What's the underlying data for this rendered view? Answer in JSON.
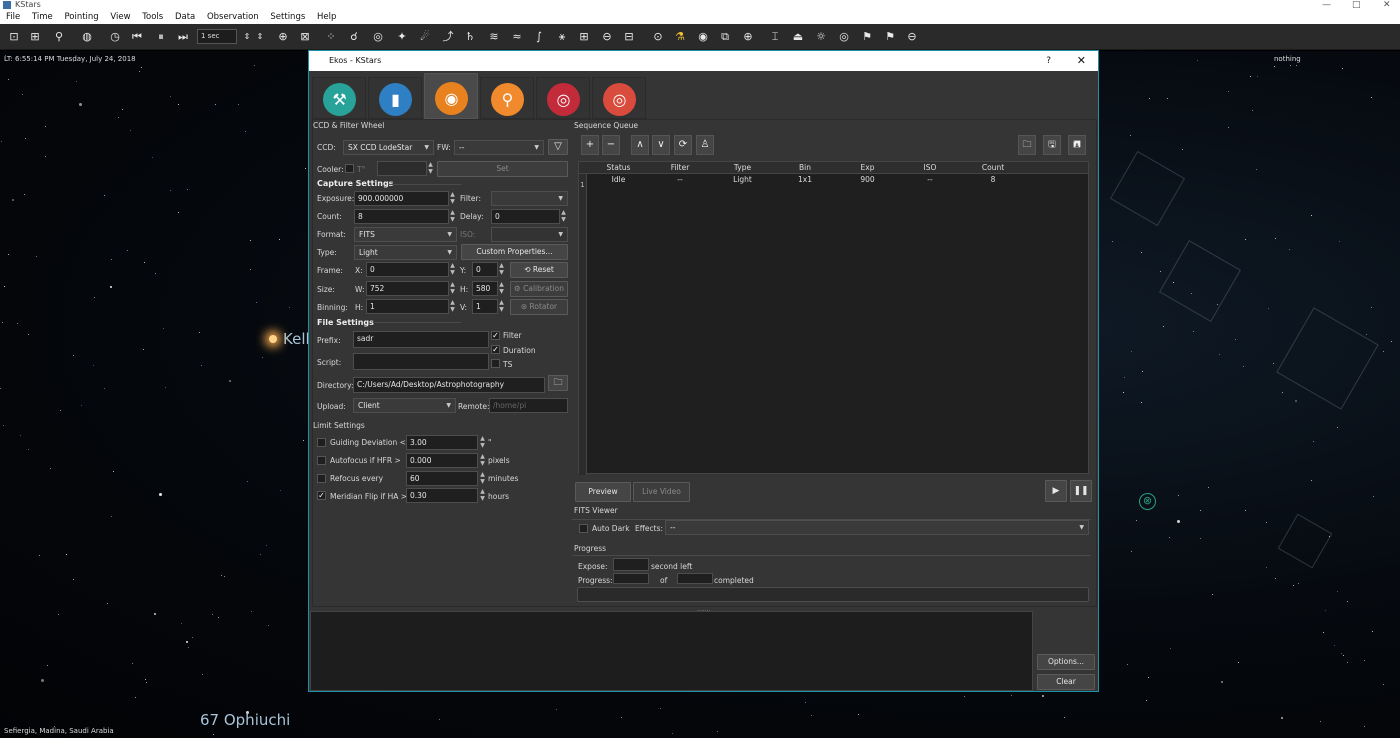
{
  "window": {
    "title": "KStars"
  },
  "menu": [
    "File",
    "Time",
    "Pointing",
    "View",
    "Tools",
    "Data",
    "Observation",
    "Settings",
    "Help"
  ],
  "toolbar": {
    "time_step": "1 sec",
    "icons": [
      "zoom-fit-icon",
      "zoom-box-icon",
      "search-icon",
      "globe-icon",
      "clock-icon",
      "skip-back-icon",
      "pause-icon",
      "step-forward-icon",
      "center-crosshair-icon",
      "fov-icon",
      "stars-icon",
      "constellation-icon",
      "galaxy-icon",
      "crosshair-star-icon",
      "comet-icon",
      "asteroid-icon",
      "planet-icon",
      "milky-way-icon",
      "equator-icon",
      "ecliptic-icon",
      "horizon-icon",
      "grid-icon",
      "ground-icon",
      "flags-icon",
      "ekos-icon",
      "telescope-icon",
      "camera-icon",
      "capture-icon",
      "mount-target-icon",
      "focus-icon",
      "lock-icon",
      "sun-icon",
      "target-icon",
      "flag-icon",
      "flag-2-icon",
      "minus-circle-icon"
    ]
  },
  "sky": {
    "lt_time": "LT: 6:55:14 PM  Tuesday, July 24, 2018",
    "object_under_cursor": "nothing",
    "location": "Sefiergia, Madina, Saudi Arabia",
    "label_kell": "Kell",
    "label_oph": "67  Ophiuchi"
  },
  "ekos": {
    "title": "Ekos - KStars",
    "help_label": "?",
    "close_label": "✕",
    "modules": [
      {
        "name": "setup",
        "icon": "wrench-icon",
        "color": "#27a39a",
        "glyph": "⚒"
      },
      {
        "name": "mount",
        "icon": "telescope-mount-icon",
        "color": "#2f7fc4",
        "glyph": "▮"
      },
      {
        "name": "capture",
        "icon": "camera-icon",
        "color": "#e8821e",
        "glyph": "◉"
      },
      {
        "name": "focus",
        "icon": "magnifier-icon",
        "color": "#f08a2c",
        "glyph": "⚲"
      },
      {
        "name": "align",
        "icon": "target-icon",
        "color": "#c42b3a",
        "glyph": "◎"
      },
      {
        "name": "guide",
        "icon": "guide-target-icon",
        "color": "#d94b3c",
        "glyph": "◎"
      }
    ],
    "ccd_group": "CCD & Filter Wheel",
    "ccd_label": "CCD:",
    "ccd_value": "SX CCD LodeStar",
    "fw_label": "FW:",
    "fw_value": "--",
    "cooler_label": "Cooler:",
    "cooler_unit": "T°",
    "set_label": "Set",
    "capture_settings": "Capture Settings",
    "exposure_label": "Exposure:",
    "exposure_value": "900.000000",
    "filter_label": "Filter:",
    "count_label": "Count:",
    "count_value": "8",
    "delay_label": "Delay:",
    "delay_value": "0",
    "format_label": "Format:",
    "format_value": "FITS",
    "iso_label": "ISO:",
    "type_label": "Type:",
    "type_value": "Light",
    "custom_props": "Custom Properties...",
    "frame_label": "Frame:",
    "x_label": "X:",
    "x_value": "0",
    "y_label": "Y:",
    "y_value": "0",
    "reset_label": "Reset",
    "size_label": "Size:",
    "w_label": "W:",
    "w_value": "752",
    "h_label": "H:",
    "h_value": "580",
    "calibration_label": "Calibration",
    "binning_label": "Binning:",
    "hb_label": "H:",
    "hb_value": "1",
    "vb_label": "V:",
    "vb_value": "1",
    "rotator_label": "Rotator",
    "file_settings": "File Settings",
    "prefix_label": "Prefix:",
    "prefix_value": "sadr",
    "filter_chk": "Filter",
    "duration_chk": "Duration",
    "ts_chk": "TS",
    "script_label": "Script:",
    "script_value": "",
    "directory_label": "Directory:",
    "directory_value": "C:/Users/Ad/Desktop/Astrophotography",
    "upload_label": "Upload:",
    "upload_value": "Client",
    "remote_label": "Remote:",
    "remote_placeholder": "/home/pi",
    "limit_settings": "Limit Settings",
    "limits": [
      {
        "label": "Guiding Deviation <",
        "value": "3.00",
        "unit": "\"",
        "checked": false
      },
      {
        "label": "Autofocus if HFR >",
        "value": "0.000",
        "unit": "pixels",
        "checked": false
      },
      {
        "label": "Refocus every",
        "value": "60",
        "unit": "minutes",
        "checked": false
      },
      {
        "label": "Meridian Flip if HA >",
        "value": "0.30",
        "unit": "hours",
        "checked": true
      }
    ],
    "sequence_queue": "Sequence Queue",
    "seq_buttons": [
      "+",
      "−",
      "∧",
      "∨",
      "⟳",
      "♙"
    ],
    "seq_columns": [
      "Status",
      "Filter",
      "Type",
      "Bin",
      "Exp",
      "ISO",
      "Count"
    ],
    "seq_rows": [
      {
        "num": "1",
        "status": "Idle",
        "filter": "--",
        "type": "Light",
        "bin": "1x1",
        "exp": "900",
        "iso": "--",
        "count": "8"
      }
    ],
    "preview_label": "Preview",
    "live_video_label": "Live Video",
    "fits_viewer": "FITS Viewer",
    "auto_dark": "Auto Dark",
    "effects_label": "Effects:",
    "effects_value": "--",
    "progress_title": "Progress",
    "expose_label": "Expose:",
    "second_left": "second left",
    "progress_label": "Progress:",
    "of_label": "of",
    "completed_label": "completed",
    "options_label": "Options...",
    "clear_label": "Clear"
  }
}
